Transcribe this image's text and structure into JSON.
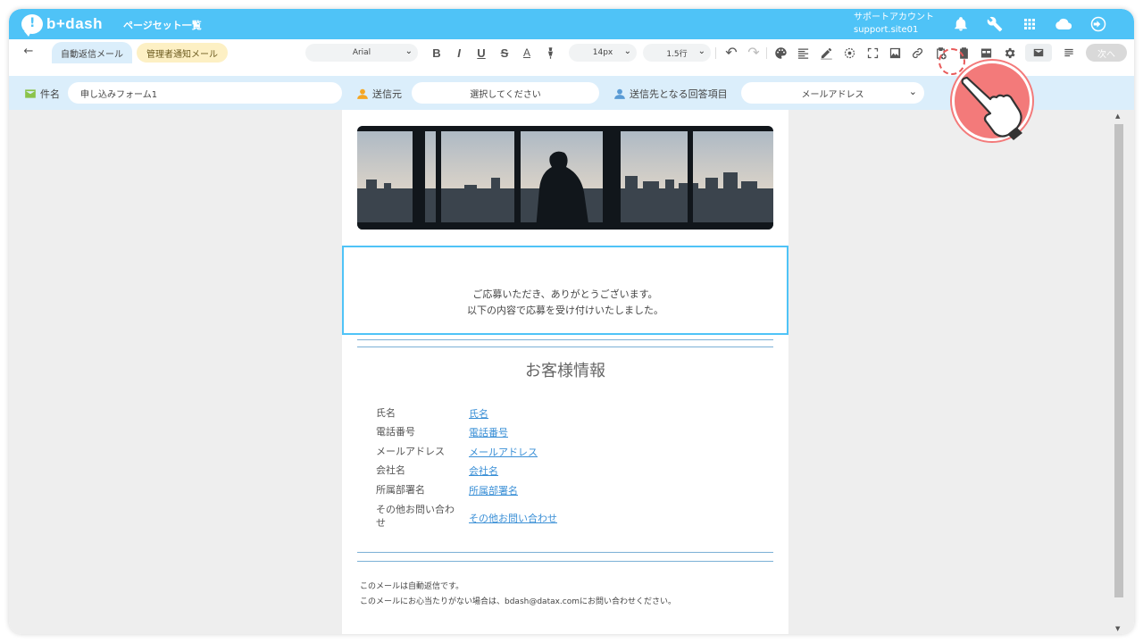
{
  "header": {
    "logo_text": "b+dash",
    "nav_link": "ページセット一覧",
    "account_name": "サポートアカウント",
    "account_site": "support.site01",
    "icons": [
      "bell-icon",
      "wrench-icon",
      "grid-icon",
      "cloud-icon",
      "logout-icon"
    ]
  },
  "toolbar": {
    "tabs": [
      {
        "label": "自動返信メール",
        "selected": true
      },
      {
        "label": "管理者通知メール",
        "selected": false
      }
    ],
    "font_family": "Arial",
    "font_size": "14px",
    "line_height": "1.5行",
    "next_label": "次へ"
  },
  "fields": {
    "subject_label": "件名",
    "subject_value": "申し込みフォーム1",
    "sender_label": "送信元",
    "sender_placeholder": "選択してください",
    "recipient_label": "送信先となる回答項目",
    "recipient_value": "メールアドレス"
  },
  "email": {
    "greeting": [
      "ご応募いただき、ありがとうございます。",
      "以下の内容で応募を受け付けいたしました。"
    ],
    "section_title": "お客様情報",
    "rows": [
      {
        "label": "氏名",
        "value": "氏名"
      },
      {
        "label": "電話番号",
        "value": "電話番号"
      },
      {
        "label": "メールアドレス",
        "value": "メールアドレス"
      },
      {
        "label": "会社名",
        "value": "会社名"
      },
      {
        "label": "所属部署名",
        "value": "所属部署名"
      },
      {
        "label": "その他お問い合わせ",
        "value": "その他お問い合わせ"
      }
    ],
    "footer": [
      "このメールは自動返信です。",
      "このメールにお心当たりがない場合は、bdash@datax.comにお問い合わせください。"
    ]
  },
  "colors": {
    "accent": "#4fc3f7",
    "field_bg": "#dbeefb",
    "link": "#3a8fd6",
    "pointer": "#f37a7a"
  }
}
